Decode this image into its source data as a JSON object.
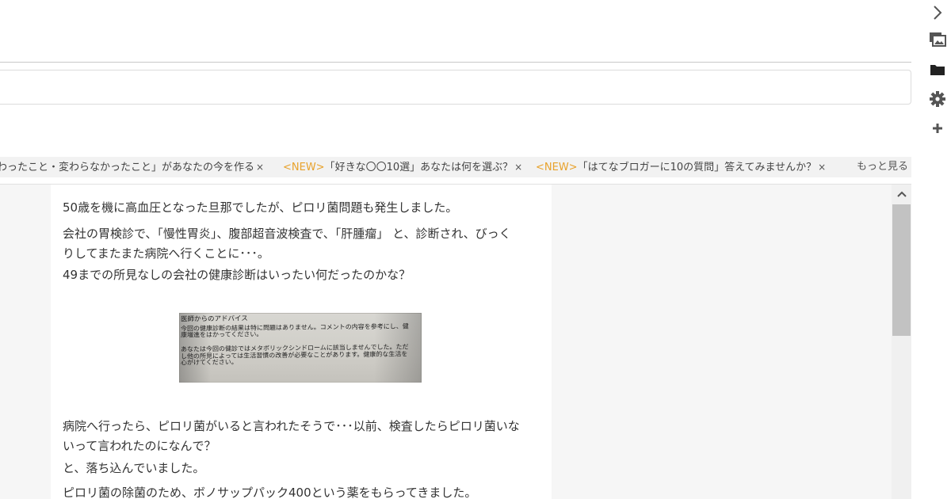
{
  "topics": {
    "items": [
      {
        "new": "",
        "text": "わったこと・変わらなかったこと」があなたの今を作る",
        "close": "×"
      },
      {
        "new": "<NEW>",
        "text": "「好きな〇〇10選」あなたは何を選ぶ？",
        "close": "×"
      },
      {
        "new": "<NEW>",
        "text": "「はてなブロガーに10の質問」答えてみませんか？",
        "close": "×"
      }
    ],
    "more_label": "もっと見る"
  },
  "article": {
    "paragraphs": [
      " 50歳を機に高血圧となった旦那でしたが、ピロリ菌問題も発生しました。",
      "会社の胃検診で、「慢性胃炎」、腹部超音波検査で、「肝腫瘤」 と、診断され、びっく",
      "りしてまたまた病院へ行くことに･･･。",
      "49までの所見なしの会社の健康診断はいったい何だったのかな？",
      "病院へ行ったら、ピロリ菌がいると言われたそうで･･･以前、検査したらピロリ菌いな",
      "いって言われたのになんで？",
      "と、落ち込んでいました。",
      "ピロリ菌の除菌のため、ボノサップパック400という薬をもらってきました。"
    ],
    "figure_lines": [
      "医師からのアドバイス",
      "今回の健康診断の結果は特に問題はありません。コメントの内容を参考にし、健",
      "康増進をはかってください。",
      "あなたは今回の健診ではメタボリックシンドロームに該当しませんでした。ただ",
      "し他の所見によっては生活習慣の改善が必要なことがあります。健康的な生活を",
      "心がけてください。"
    ]
  },
  "scrollbar": {
    "up_arrow": "^"
  },
  "side_toolbar": {
    "icons": [
      "chevron-right-icon",
      "image-icon",
      "folder-icon",
      "gear-icon",
      "plus-icon"
    ]
  }
}
